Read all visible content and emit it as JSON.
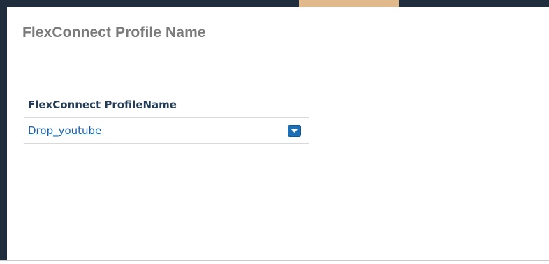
{
  "page": {
    "title": "FlexConnect Profile Name"
  },
  "table": {
    "header": "FlexConnect ProfileName",
    "rows": [
      {
        "name": "Drop_youtube"
      }
    ]
  },
  "icons": {
    "row_action": "chevron-down-icon"
  },
  "colors": {
    "frame": "#1f2d3d",
    "accent": "#e2b98a",
    "title": "#7a7a7a",
    "header_text": "#243c55",
    "link": "#1a5fa8",
    "dropdown_button": "#1f6fb5"
  }
}
